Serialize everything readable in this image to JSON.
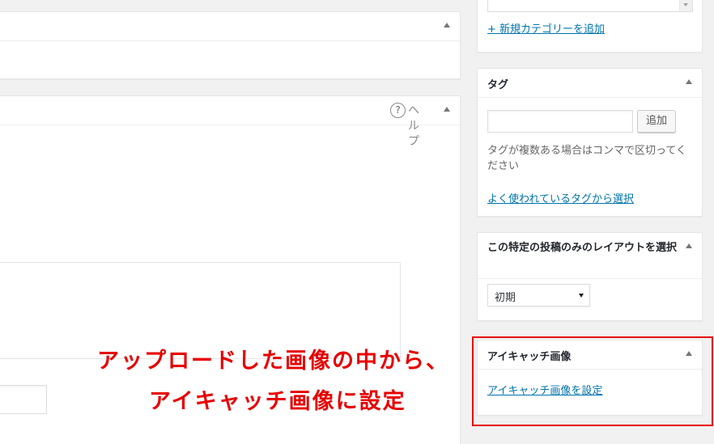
{
  "category_box": {
    "add_category_link": "+ 新規カテゴリーを追加"
  },
  "tag_box": {
    "title": "タグ",
    "add_button": "追加",
    "help_text": "タグが複数ある場合はコンマで区切ってください",
    "popular_tags_link": "よく使われているタグから選択"
  },
  "layout_box": {
    "title": "この特定の投稿のみのレイアウトを選択",
    "selected_option": "初期"
  },
  "featured_image_box": {
    "title": "アイキャッチ画像",
    "set_link": "アイキャッチ画像を設定"
  },
  "editor": {
    "help_label": "ヘルプ"
  },
  "annotation": {
    "line1": "アップロードした画像の中から、",
    "line2": "アイキャッチ画像に設定",
    "color": "#e60000"
  },
  "colors": {
    "link": "#0073aa",
    "highlight_border": "#e60000",
    "background": "#f1f1f1"
  }
}
